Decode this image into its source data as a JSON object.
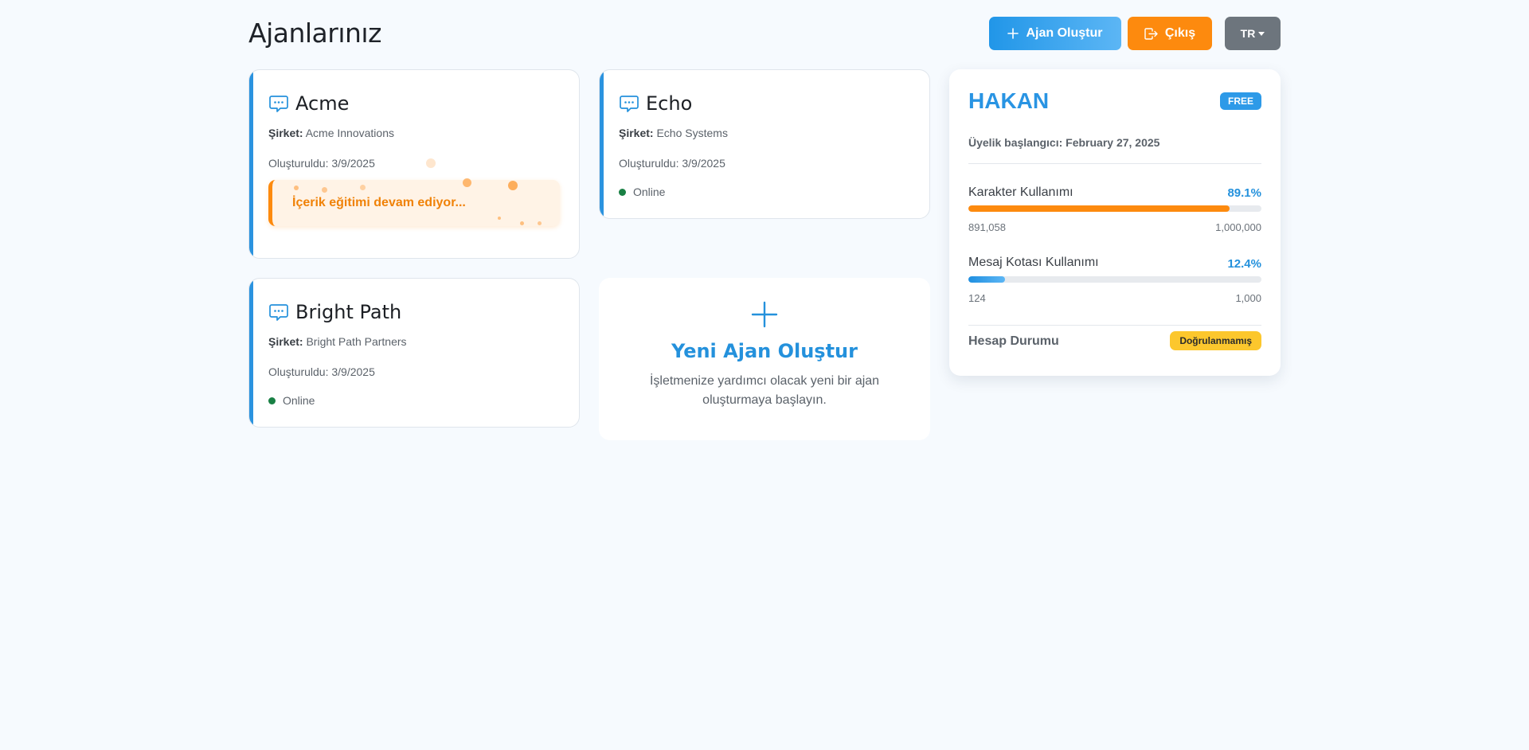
{
  "header": {
    "title": "Ajanlarınız",
    "create_button": "Ajan Oluştur",
    "logout_button": "Çıkış",
    "language": "TR"
  },
  "agents": [
    {
      "name": "Acme",
      "company_label": "Şirket:",
      "company": "Acme Innovations",
      "created": "Oluşturuldu: 3/9/2025",
      "training_text": "İçerik eğitimi devam ediyor..."
    },
    {
      "name": "Echo",
      "company_label": "Şirket:",
      "company": "Echo Systems",
      "created": "Oluşturuldu: 3/9/2025",
      "status": "Online"
    },
    {
      "name": "Bright Path",
      "company_label": "Şirket:",
      "company": "Bright Path Partners",
      "created": "Oluşturuldu: 3/9/2025",
      "status": "Online"
    }
  ],
  "new_agent": {
    "title": "Yeni Ajan Oluştur",
    "description": "İşletmenize yardımcı olacak yeni bir ajan oluşturmaya başlayın."
  },
  "profile": {
    "name": "HAKAN",
    "plan": "FREE",
    "member_since": "Üyelik başlangıcı: February 27, 2025",
    "character_usage": {
      "label": "Karakter Kullanımı",
      "percent": "89.1%",
      "fraction": 0.891,
      "used": "891,058",
      "limit": "1,000,000"
    },
    "message_usage": {
      "label": "Mesaj Kotası Kullanımı",
      "percent": "12.4%",
      "fraction": 0.124,
      "used": "124",
      "limit": "1,000"
    },
    "account_status_label": "Hesap Durumu",
    "account_status": "Doğrulanmamış"
  },
  "colors": {
    "accent": "#2491dc",
    "warning": "#fd8a0e",
    "online": "#198044",
    "badge_unverified": "#fcc72d"
  }
}
